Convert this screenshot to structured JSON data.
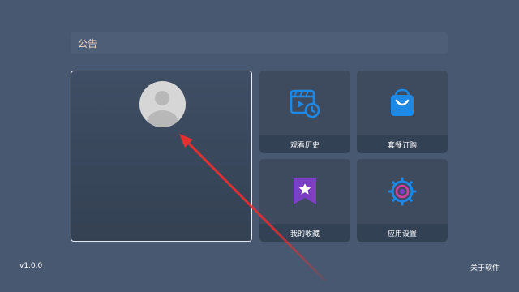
{
  "notice": {
    "label": "公告"
  },
  "menu": {
    "history": {
      "label": "观看历史",
      "icon": "history-icon"
    },
    "plan": {
      "label": "套餐订购",
      "icon": "shopping-bag-icon"
    },
    "favorites": {
      "label": "我的收藏",
      "icon": "bookmark-star-icon"
    },
    "settings": {
      "label": "应用设置",
      "icon": "gear-icon"
    }
  },
  "footer": {
    "version": "v1.0.0",
    "about": "关于软件"
  },
  "colors": {
    "background": "#475870",
    "notice_text": "#f0d4c2",
    "accent_blue": "#1e88e5",
    "accent_purple": "#7b3fc4",
    "accent_pink": "#d63fa0",
    "annotation_red": "#e53030"
  }
}
